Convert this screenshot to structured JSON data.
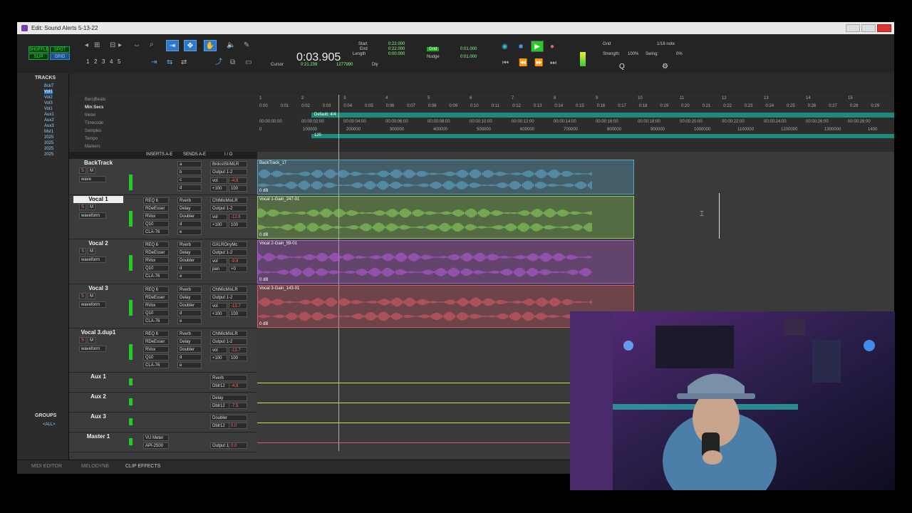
{
  "window": {
    "title": "Edit: Sound Alerts 5-13-22"
  },
  "toolbar": {
    "modes": [
      "SHUFFLE",
      "SPOT",
      "SLIP",
      "GRID"
    ],
    "zoom_presets": [
      "1",
      "2",
      "3",
      "4",
      "5"
    ],
    "main_counter": "0:03.905",
    "cursor_label": "Cursor",
    "cursor_value": "0:21.239",
    "samples_value": "1277990",
    "start_label": "Start",
    "end_label": "End",
    "length_label": "Length",
    "start_value": "0:22.000",
    "end_value": "0:22.000",
    "length_value": "0:00.000",
    "grid_label": "Grid",
    "grid_value": "0:01.000",
    "nudge_label": "Nudge",
    "nudge_value": "0:01.000",
    "dly_label": "Dly",
    "grid2_label": "Grid",
    "grid_note": "1/16 note",
    "strength_label": "Strength:",
    "strength_value": "100%",
    "swing_label": "Swing:",
    "swing_value": "0%"
  },
  "tracklist": {
    "header": "TRACKS",
    "items": [
      "BckT",
      "Vol1",
      "Vol2",
      "Vol3",
      "Vol1",
      "Aux1",
      "Aux2",
      "Aux3",
      "Mst1",
      "2025",
      "2025",
      "2025",
      "2025"
    ],
    "groups_header": "GROUPS",
    "groups_item": "<ALL>"
  },
  "rulers": {
    "labels": [
      "Bars|Beats",
      "Min:Secs",
      "Meter",
      "Timecode",
      "Samples",
      "Tempo",
      "Markers"
    ],
    "bars": [
      "1",
      "2",
      "3",
      "4",
      "5",
      "6",
      "7",
      "8",
      "9",
      "10",
      "11",
      "12",
      "13",
      "14",
      "15"
    ],
    "minsecs": [
      "0:00",
      "0:01",
      "0:02",
      "0:03",
      "0:04",
      "0:05",
      "0:06",
      "0:07",
      "0:08",
      "0:09",
      "0:10",
      "0:11",
      "0:12",
      "0:13",
      "0:14",
      "0:15",
      "0:16",
      "0:17",
      "0:18",
      "0:19",
      "0:20",
      "0:21",
      "0:22",
      "0:23",
      "0:24",
      "0:25",
      "0:26",
      "0:27",
      "0:28",
      "0:29"
    ],
    "meter": "Default: 4/4",
    "timecode": [
      "00:00:00:00",
      "00:00:02:00",
      "00:00:04:00",
      "00:00:06:00",
      "00:00:08:00",
      "00:00:10:00",
      "00:00:12:00",
      "00:00:14:00",
      "00:00:16:00",
      "00:00:18:00",
      "00:00:20:00",
      "00:00:22:00",
      "00:00:24:00",
      "00:00:26:00",
      "00:00:28:00"
    ],
    "samples": [
      "0",
      "100000",
      "200000",
      "300000",
      "400000",
      "500000",
      "600000",
      "700000",
      "800000",
      "900000",
      "1000000",
      "1100000",
      "1200000",
      "1300000",
      "1400"
    ],
    "tempo": "120"
  },
  "columns": {
    "inserts": "INSERTS A-E",
    "sends": "SENDS A-E",
    "io": "I / O"
  },
  "tracks": [
    {
      "name": "BackTrack",
      "inserts": [],
      "sends": [
        "a",
        "b",
        "c",
        "d"
      ],
      "out": "BrdcstStrMLR",
      "bus": "Output 1-2",
      "vol": "vol",
      "volv": "-4.9",
      "pan": "+100",
      "panv": "100",
      "view": "wave"
    },
    {
      "name": "Vocal 1",
      "inserts": [
        "REQ 6",
        "RDeEsser",
        "RVox",
        "Q10",
        "CLA-76"
      ],
      "sends": [
        "Rverb",
        "Delay",
        "Doubler",
        "d",
        "e"
      ],
      "out": "ChtMicMixLR",
      "bus": "Output 1-2",
      "vol": "vol",
      "volv": "-12.6",
      "pan": "+100",
      "panv": "100",
      "view": "waveform"
    },
    {
      "name": "Vocal 2",
      "inserts": [
        "REQ 6",
        "RDeEsser",
        "RVox",
        "Q10",
        "CLA-76"
      ],
      "sends": [
        "Rverb",
        "Delay",
        "Doubler",
        "d",
        "e"
      ],
      "out": "GXLROnyMc",
      "bus": "Output 1-2",
      "vol": "vol",
      "volv": "-9.9",
      "pan": "pan",
      "panv": "+0",
      "view": "waveform"
    },
    {
      "name": "Vocal 3",
      "inserts": [
        "REQ 6",
        "RDeEsser",
        "RVox",
        "Q10",
        "CLA-76"
      ],
      "sends": [
        "Rverb",
        "Delay",
        "Doubler",
        "d",
        "e"
      ],
      "out": "ChtMicMixLR",
      "bus": "Output 1-2",
      "vol": "vol",
      "volv": "-13.7",
      "pan": "+100",
      "panv": "100",
      "view": "waveform"
    },
    {
      "name": "Vocal 3.dup1",
      "inserts": [
        "REQ 6",
        "RDeEsser",
        "RVox",
        "Q10",
        "CLA-76"
      ],
      "sends": [
        "Rverb",
        "Delay",
        "Doubler",
        "d",
        "e"
      ],
      "out": "ChtMicMixLR",
      "bus": "Output 1-2",
      "vol": "vol",
      "volv": "-13.7",
      "pan": "+100",
      "panv": "100",
      "view": "waveform"
    },
    {
      "name": "Aux 1",
      "inserts": [],
      "sends": [],
      "out": "Rverb",
      "bus": "Dblr12",
      "vol": "vol",
      "volv": "-4.9"
    },
    {
      "name": "Aux 2",
      "inserts": [],
      "sends": [],
      "out": "Delay",
      "bus": "Dblr12",
      "vol": "vol",
      "volv": "-7.5"
    },
    {
      "name": "Aux 3",
      "inserts": [],
      "sends": [],
      "out": "Doubler",
      "bus": "Dblr12",
      "vol": "vol",
      "volv": "0.0"
    },
    {
      "name": "Master 1",
      "inserts": [
        "VU Meter",
        "API-2500"
      ],
      "sends": [],
      "out": "",
      "bus": "Output 1-2",
      "vol": "vol",
      "volv": "0.0",
      "view": "volume"
    }
  ],
  "clips": [
    {
      "name": "BackTrack_17",
      "db": "0 dB",
      "color": "#5aa8c8"
    },
    {
      "name": "Vocal 1-Gain_247-01",
      "db": "0 dB",
      "color": "#8bcf5a"
    },
    {
      "name": "Vocal 2-Gain_59-01",
      "db": "0 dB",
      "color": "#b35ad6"
    },
    {
      "name": "Vocal 3-Gain_143-01",
      "db": "0 dB",
      "color": "#d65a6a"
    }
  ],
  "bottom": {
    "tabs": [
      "MIDI EDITOR",
      "MELODYNE",
      "CLIP EFFECTS"
    ]
  },
  "colors": {
    "accent": "#2d78c8",
    "meter": "#1e8a7a"
  }
}
